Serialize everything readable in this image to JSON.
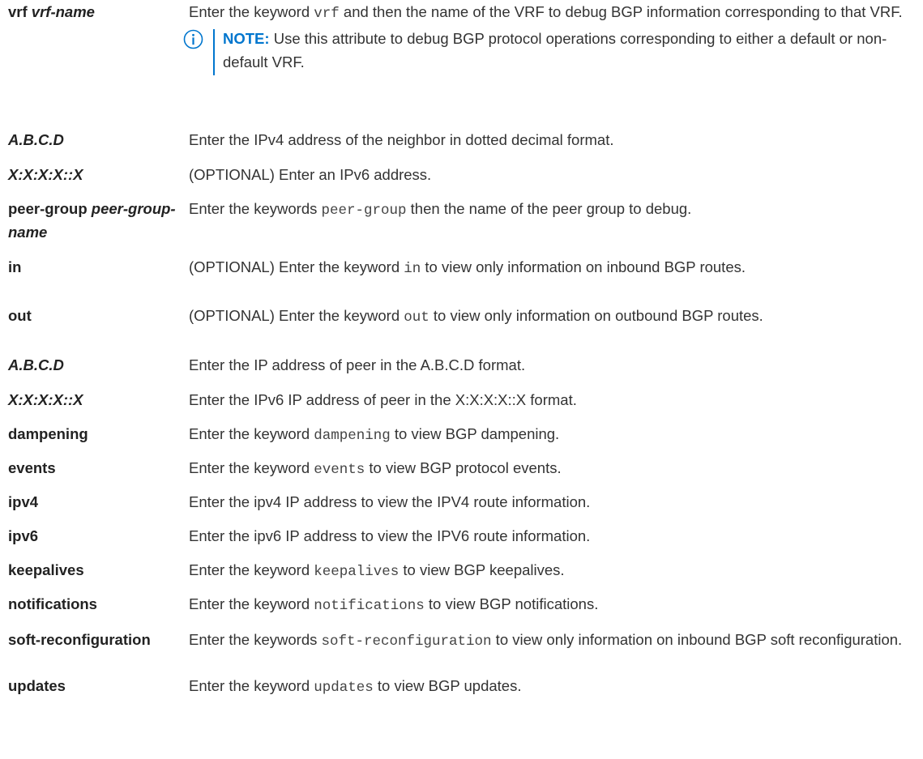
{
  "rows": [
    {
      "param": [
        {
          "text": "vrf "
        },
        {
          "text": "vrf-name",
          "italic": true
        }
      ],
      "desc": [
        {
          "text": "Enter the keyword "
        },
        {
          "text": "vrf",
          "code": true
        },
        {
          "text": " and then the name of the VRF to debug BGP information corresponding to that VRF."
        }
      ],
      "note": {
        "label": "NOTE:",
        "text": "Use this attribute to debug BGP protocol operations corresponding to either a default or non-default VRF.",
        "icon": "info-circle-icon"
      }
    },
    {
      "param": [
        {
          "text": "A.B.C.D",
          "italic": true
        }
      ],
      "desc": [
        {
          "text": "Enter the IPv4 address of the neighbor in dotted decimal format."
        }
      ]
    },
    {
      "param": [
        {
          "text": "X:X:X:X::X",
          "italic": true
        }
      ],
      "desc": [
        {
          "text": "(OPTIONAL) Enter an IPv6 address."
        }
      ]
    },
    {
      "param": [
        {
          "text": "peer-group "
        },
        {
          "text": "peer-group-name",
          "italic": true
        }
      ],
      "desc": [
        {
          "text": "Enter the keywords "
        },
        {
          "text": "peer-group",
          "code": true
        },
        {
          "text": " then the name of the peer group to debug."
        }
      ]
    },
    {
      "param": [
        {
          "text": "in"
        }
      ],
      "desc": [
        {
          "text": "(OPTIONAL) Enter the keyword "
        },
        {
          "text": "in",
          "code": true
        },
        {
          "text": " to view only information on inbound BGP routes."
        }
      ]
    },
    {
      "param": [
        {
          "text": "out"
        }
      ],
      "desc": [
        {
          "text": "(OPTIONAL) Enter the keyword "
        },
        {
          "text": "out",
          "code": true
        },
        {
          "text": " to view only information on outbound BGP routes."
        }
      ]
    },
    {
      "param": [
        {
          "text": "A.B.C.D",
          "italic": true
        }
      ],
      "desc": [
        {
          "text": "Enter the IP address of peer in the A.B.C.D format."
        }
      ]
    },
    {
      "param": [
        {
          "text": "X:X:X:X::X",
          "italic": true
        }
      ],
      "desc": [
        {
          "text": "Enter the IPv6 IP address of peer in the X:X:X:X::X format."
        }
      ]
    },
    {
      "param": [
        {
          "text": "dampening"
        }
      ],
      "desc": [
        {
          "text": "Enter the keyword "
        },
        {
          "text": "dampening",
          "code": true
        },
        {
          "text": " to view BGP dampening."
        }
      ]
    },
    {
      "param": [
        {
          "text": "events"
        }
      ],
      "desc": [
        {
          "text": "Enter the keyword "
        },
        {
          "text": "events",
          "code": true
        },
        {
          "text": " to view BGP protocol events."
        }
      ]
    },
    {
      "param": [
        {
          "text": "ipv4"
        }
      ],
      "desc": [
        {
          "text": "Enter the ipv4 IP address to view the IPV4 route information."
        }
      ]
    },
    {
      "param": [
        {
          "text": "ipv6"
        }
      ],
      "desc": [
        {
          "text": "Enter the ipv6 IP address to view the IPV6 route information."
        }
      ]
    },
    {
      "param": [
        {
          "text": "keepalives"
        }
      ],
      "desc": [
        {
          "text": "Enter the keyword "
        },
        {
          "text": "keepalives",
          "code": true
        },
        {
          "text": " to view BGP keepalives."
        }
      ]
    },
    {
      "param": [
        {
          "text": "notifications"
        }
      ],
      "desc": [
        {
          "text": "Enter the keyword "
        },
        {
          "text": "notifications",
          "code": true
        },
        {
          "text": " to view BGP notifications."
        }
      ]
    },
    {
      "param": [
        {
          "text": "soft-reconfiguration"
        }
      ],
      "desc": [
        {
          "text": "Enter the keywords "
        },
        {
          "text": "soft-reconfiguration",
          "code": true
        },
        {
          "text": " to view only information on inbound BGP soft reconfiguration."
        }
      ]
    },
    {
      "param": [
        {
          "text": "updates"
        }
      ],
      "desc": [
        {
          "text": "Enter the keyword "
        },
        {
          "text": "updates",
          "code": true
        },
        {
          "text": " to view BGP updates."
        }
      ]
    }
  ]
}
